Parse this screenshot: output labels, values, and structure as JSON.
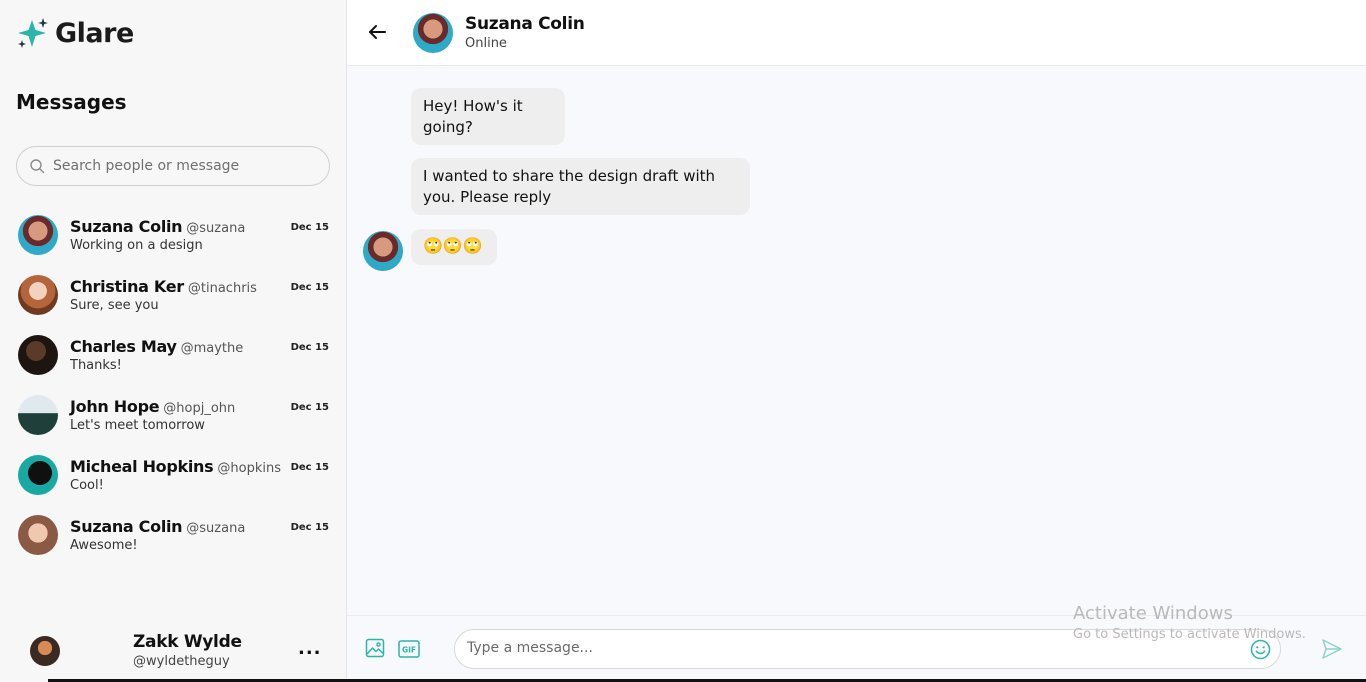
{
  "app": {
    "brand": "Glare",
    "accent_color": "#2bb5a6"
  },
  "sidebar": {
    "title": "Messages",
    "search_placeholder": "Search people or message",
    "conversations": [
      {
        "name": "Suzana Colin",
        "handle": "@suzana",
        "preview": "Working on a design",
        "date": "Dec 15",
        "avatar_bg": "#2fa9c8"
      },
      {
        "name": "Christina Ker",
        "handle": "@tinachris",
        "preview": "Sure, see you",
        "date": "Dec 15",
        "avatar_bg": "#a0522d"
      },
      {
        "name": "Charles May",
        "handle": "@maythe",
        "preview": "Thanks!",
        "date": "Dec 15",
        "avatar_bg": "#2a1d16"
      },
      {
        "name": "John Hope",
        "handle": "@hopj_ohn",
        "preview": "Let's meet tomorrow",
        "date": "Dec 15",
        "avatar_bg": "#c9dce6"
      },
      {
        "name": "Micheal Hopkins",
        "handle": "@hopkins",
        "preview": "Cool!",
        "date": "Dec 15",
        "avatar_bg": "#19a9a3"
      },
      {
        "name": "Suzana Colin",
        "handle": "@suzana",
        "preview": "Awesome!",
        "date": "Dec 15",
        "avatar_bg": "#8a5a45"
      }
    ],
    "profile": {
      "name": "Zakk Wylde",
      "handle": "@wyldetheguy",
      "more_label": "..."
    }
  },
  "chat": {
    "contact_name": "Suzana Colin",
    "contact_status": "Online",
    "messages": [
      {
        "text": "Hey! How's it going?"
      },
      {
        "text": "I wanted to share the design draft with you. Please reply"
      },
      {
        "text": "🙄🙄🙄"
      }
    ],
    "input_placeholder": "Type a message..."
  },
  "watermark": {
    "line1": "Activate Windows",
    "line2": "Go to Settings to activate Windows."
  }
}
